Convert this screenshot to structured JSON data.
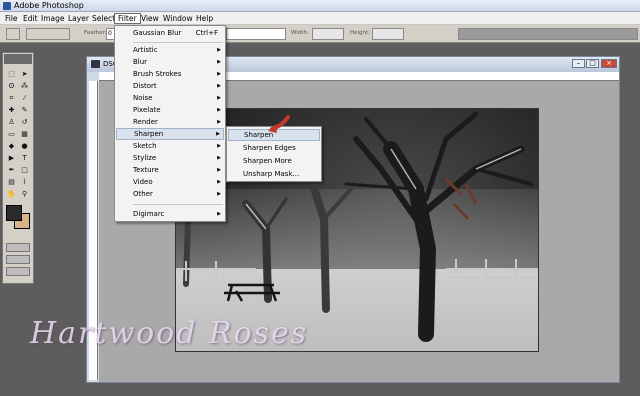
{
  "app": {
    "title": "Adobe Photoshop"
  },
  "menubar": {
    "items": [
      {
        "label": "File"
      },
      {
        "label": "Edit"
      },
      {
        "label": "Image"
      },
      {
        "label": "Layer"
      },
      {
        "label": "Select"
      },
      {
        "label": "Filter"
      },
      {
        "label": "View"
      },
      {
        "label": "Window"
      },
      {
        "label": "Help"
      }
    ]
  },
  "options_bar": {
    "feather_label": "Feather:",
    "feather_value": "0",
    "width_label": "Width:",
    "height_label": "Height:"
  },
  "document": {
    "title": "DSC"
  },
  "filter_menu": {
    "items": [
      {
        "label": "Gaussian Blur",
        "shortcut": "Ctrl+F"
      },
      {
        "label": "Artistic",
        "submenu": true
      },
      {
        "label": "Blur",
        "submenu": true
      },
      {
        "label": "Brush Strokes",
        "submenu": true
      },
      {
        "label": "Distort",
        "submenu": true
      },
      {
        "label": "Noise",
        "submenu": true
      },
      {
        "label": "Pixelate",
        "submenu": true
      },
      {
        "label": "Render",
        "submenu": true
      },
      {
        "label": "Sharpen",
        "submenu": true,
        "highlighted": true
      },
      {
        "label": "Sketch",
        "submenu": true
      },
      {
        "label": "Stylize",
        "submenu": true
      },
      {
        "label": "Texture",
        "submenu": true
      },
      {
        "label": "Video",
        "submenu": true
      },
      {
        "label": "Other",
        "submenu": true
      },
      {
        "label": "Digimarc",
        "submenu": true
      }
    ]
  },
  "sharpen_submenu": {
    "items": [
      {
        "label": "Sharpen",
        "highlighted": true
      },
      {
        "label": "Sharpen Edges"
      },
      {
        "label": "Sharpen More"
      },
      {
        "label": "Unsharp Mask..."
      }
    ]
  },
  "watermark": {
    "text": "Hartwood Roses"
  },
  "colors": {
    "foreground": "#2b2b2b",
    "background": "#d9b48a",
    "pointer": "#c0392b"
  }
}
